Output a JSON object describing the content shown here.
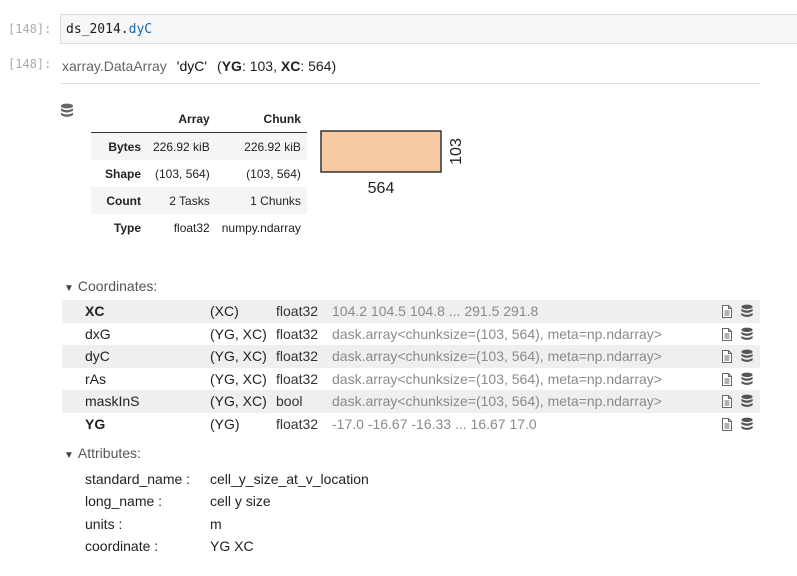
{
  "cell": {
    "input_prompt": "[148]:",
    "output_prompt": "[148]:",
    "code_object": "ds_2014.",
    "code_attr": "dyC"
  },
  "array": {
    "class_name": "xarray.DataArray",
    "name": "'dyC'",
    "dims_open": "(",
    "dim1_name": "YG",
    "dim1_rest": ": 103, ",
    "dim2_name": "XC",
    "dim2_rest": ": 564)"
  },
  "dask_table": {
    "headers": [
      "",
      "Array",
      "Chunk"
    ],
    "rows": [
      {
        "label": "Bytes",
        "array": "226.92 kiB",
        "chunk": "226.92 kiB"
      },
      {
        "label": "Shape",
        "array": "(103, 564)",
        "chunk": "(103, 564)"
      },
      {
        "label": "Count",
        "array": "2 Tasks",
        "chunk": "1 Chunks"
      },
      {
        "label": "Type",
        "array": "float32",
        "chunk": "numpy.ndarray"
      }
    ]
  },
  "chunk_graphic": {
    "width_label": "564",
    "height_label": "103",
    "fill_color": "#f6cba4",
    "stroke_color": "#333333"
  },
  "coordinates": {
    "title": "Coordinates:",
    "rows": [
      {
        "name": "XC",
        "dims": "(XC)",
        "dtype": "float32",
        "preview": "104.2 104.5 104.8 ... 291.5 291.8",
        "is_dim": true
      },
      {
        "name": "dxG",
        "dims": "(YG, XC)",
        "dtype": "float32",
        "preview": "dask.array<chunksize=(103, 564), meta=np.ndarray>",
        "is_dim": false
      },
      {
        "name": "dyC",
        "dims": "(YG, XC)",
        "dtype": "float32",
        "preview": "dask.array<chunksize=(103, 564), meta=np.ndarray>",
        "is_dim": false
      },
      {
        "name": "rAs",
        "dims": "(YG, XC)",
        "dtype": "float32",
        "preview": "dask.array<chunksize=(103, 564), meta=np.ndarray>",
        "is_dim": false
      },
      {
        "name": "maskInS",
        "dims": "(YG, XC)",
        "dtype": "bool",
        "preview": "dask.array<chunksize=(103, 564), meta=np.ndarray>",
        "is_dim": false
      },
      {
        "name": "YG",
        "dims": "(YG)",
        "dtype": "float32",
        "preview": "-17.0 -16.67 -16.33 ... 16.67 17.0",
        "is_dim": true
      }
    ]
  },
  "attributes": {
    "title": "Attributes:",
    "rows": [
      {
        "key": "standard_name :",
        "value": "cell_y_size_at_v_location"
      },
      {
        "key": "long_name :",
        "value": "cell y size"
      },
      {
        "key": "units :",
        "value": "m"
      },
      {
        "key": "coordinate :",
        "value": "YG XC"
      }
    ]
  },
  "icons": {
    "section_toggle": "triangle-down-icon",
    "attrs_toggle": "file-icon",
    "data_toggle": "database-icon"
  }
}
